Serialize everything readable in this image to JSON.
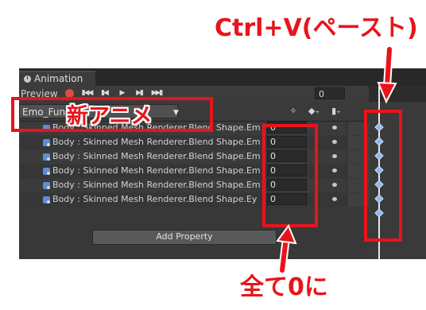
{
  "window": {
    "tab_title": "Animation",
    "preview_label": "Preview",
    "frame_value": "0",
    "clip_name": "Emo_Fun",
    "add_property_label": "Add Property"
  },
  "toolbar_icons": [
    "record-icon",
    "first-key-icon",
    "prev-key-icon",
    "play-icon",
    "next-key-icon",
    "last-key-icon"
  ],
  "properties": [
    {
      "label": "Body : Skinned Mesh Renderer.Blend Shape.Em",
      "value": "0"
    },
    {
      "label": "Body : Skinned Mesh Renderer.Blend Shape.Em",
      "value": "0"
    },
    {
      "label": "Body : Skinned Mesh Renderer.Blend Shape.Em",
      "value": "0"
    },
    {
      "label": "Body : Skinned Mesh Renderer.Blend Shape.Em",
      "value": "0"
    },
    {
      "label": "Body : Skinned Mesh Renderer.Blend Shape.Em",
      "value": "0"
    },
    {
      "label": "Body : Skinned Mesh Renderer.Blend Shape.Ey",
      "value": "0"
    }
  ],
  "annotations": {
    "paste": "Ctrl+V(ペースト)",
    "new_anime": "新アニメ",
    "all_zero": "全て0に"
  },
  "colors": {
    "highlight_red": "#e8141c",
    "record_red": "#e04b3c",
    "keyframe_blue": "#8fb8ea"
  }
}
